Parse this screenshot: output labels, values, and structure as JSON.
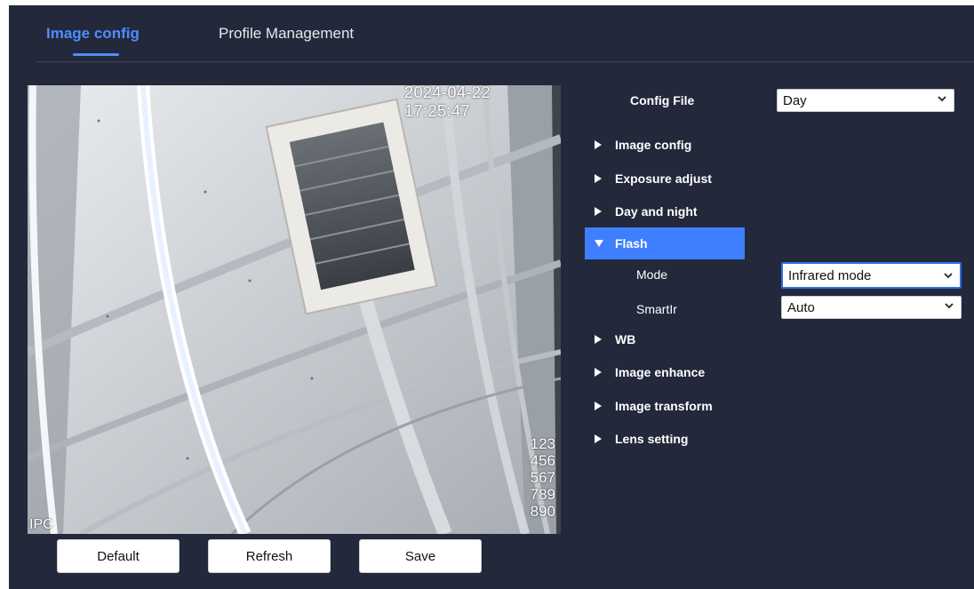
{
  "tabs": [
    {
      "label": "Image config",
      "active": true
    },
    {
      "label": "Profile Management",
      "active": false
    }
  ],
  "video": {
    "timestamp": "2024-04-22 17:25:47",
    "osd_lines": [
      "123",
      "456",
      "567",
      "789",
      "890"
    ],
    "channel_name": "IPC"
  },
  "buttons": {
    "default": "Default",
    "refresh": "Refresh",
    "save": "Save"
  },
  "config_file": {
    "label": "Config File",
    "value": "Day"
  },
  "sections": [
    {
      "label": "Image config",
      "expanded": false
    },
    {
      "label": "Exposure adjust",
      "expanded": false
    },
    {
      "label": "Day and night",
      "expanded": false
    },
    {
      "label": "Flash",
      "expanded": true
    },
    {
      "label": "WB",
      "expanded": false
    },
    {
      "label": "Image enhance",
      "expanded": false
    },
    {
      "label": "Image transform",
      "expanded": false
    },
    {
      "label": "Lens setting",
      "expanded": false
    }
  ],
  "flash": {
    "mode_label": "Mode",
    "mode_value": "Infrared mode",
    "smartir_label": "SmartIr",
    "smartir_value": "Auto"
  },
  "colors": {
    "background": "#23283a",
    "accent": "#4d8dff",
    "active_row": "#3f7fff"
  }
}
